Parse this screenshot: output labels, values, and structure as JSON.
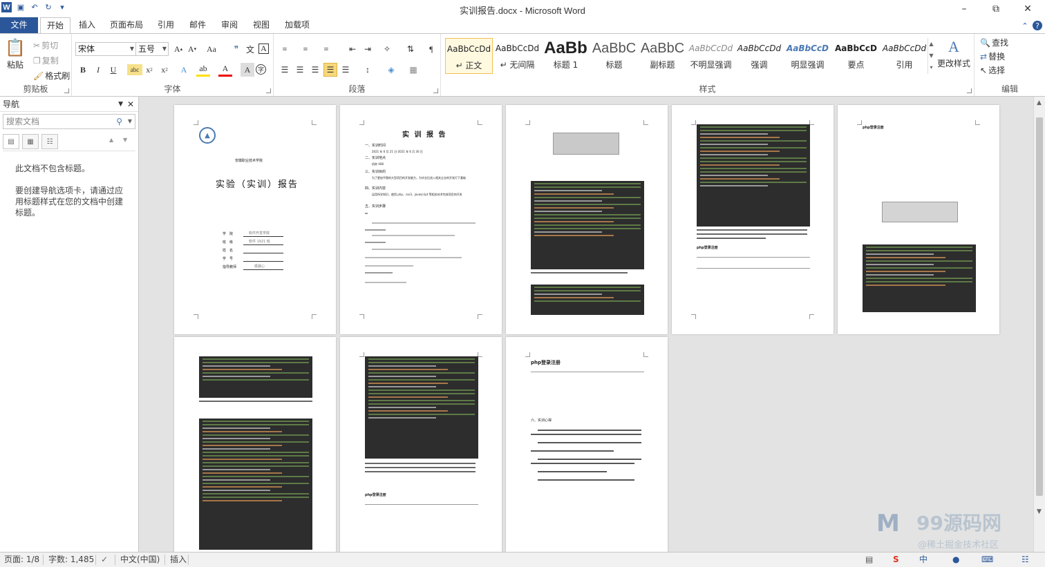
{
  "window": {
    "title": "实训报告.docx - Microsoft Word"
  },
  "tabs": [
    "文件",
    "开始",
    "插入",
    "页面布局",
    "引用",
    "邮件",
    "审阅",
    "视图",
    "加载项"
  ],
  "clipboard": {
    "paste": "粘贴",
    "cut": "剪切",
    "copy": "复制",
    "format_painter": "格式刷",
    "group": "剪贴板"
  },
  "font": {
    "name": "宋体",
    "size": "五号",
    "group": "字体"
  },
  "paragraph": {
    "group": "段落"
  },
  "styles": {
    "group": "样式",
    "change": "更改样式",
    "items": [
      {
        "preview": "AaBbCcDd",
        "name": "↵ 正文"
      },
      {
        "preview": "AaBbCcDd",
        "name": "↵ 无间隔"
      },
      {
        "preview": "AaBb",
        "name": "标题 1"
      },
      {
        "preview": "AaBbC",
        "name": "标题"
      },
      {
        "preview": "AaBbC",
        "name": "副标题"
      },
      {
        "preview": "AaBbCcDd",
        "name": "不明显强调"
      },
      {
        "preview": "AaBbCcDd",
        "name": "强调"
      },
      {
        "preview": "AaBbCcD",
        "name": "明显强调"
      },
      {
        "preview": "AaBbCcD",
        "name": "要点"
      },
      {
        "preview": "AaBbCcDd",
        "name": "引用"
      }
    ]
  },
  "editing": {
    "find": "查找",
    "replace": "替换",
    "select": "选择",
    "group": "编辑"
  },
  "nav": {
    "title": "导航",
    "search_placeholder": "搜索文档",
    "msg1": "此文档不包含标题。",
    "msg2": "要创建导航选项卡，请通过应用标题样式在您的文档中创建标题。"
  },
  "doc": {
    "school": "安徽职业技术学院",
    "report_title": "实验（实训）报告",
    "fields": [
      "学　院",
      "班　级",
      "姓　名",
      "学　号",
      "指导教师"
    ],
    "filled": [
      "软件开发学院",
      "软件 1921 班",
      "",
      "",
      "侯晨心"
    ],
    "p2_title": "实 训 报 告",
    "p2_sections": [
      "一、实训时间",
      "二、实训地点",
      "三、实训目的",
      "四、实训内容",
      "五、实训步骤"
    ],
    "p2_lines": [
      "2021 年 6 月 21 日-2021 年 6 月 30 日",
      "机房 408",
      "为了更加平稳的大型项目的开发能力，为毕业后进入相关企业的开发打下基础",
      "运用所学知识，使用 php、css3、javascript 等相关技术完成项目的开发"
    ],
    "php_title": "php登录注册",
    "summary": "六、实训心得"
  },
  "status": {
    "page": "页面: 1/8",
    "words": "字数: 1,485",
    "lang": "中文(中国)",
    "mode": "插入"
  },
  "watermark": {
    "brand": "99源码网",
    "sub": "@稀土掘金技术社区"
  }
}
